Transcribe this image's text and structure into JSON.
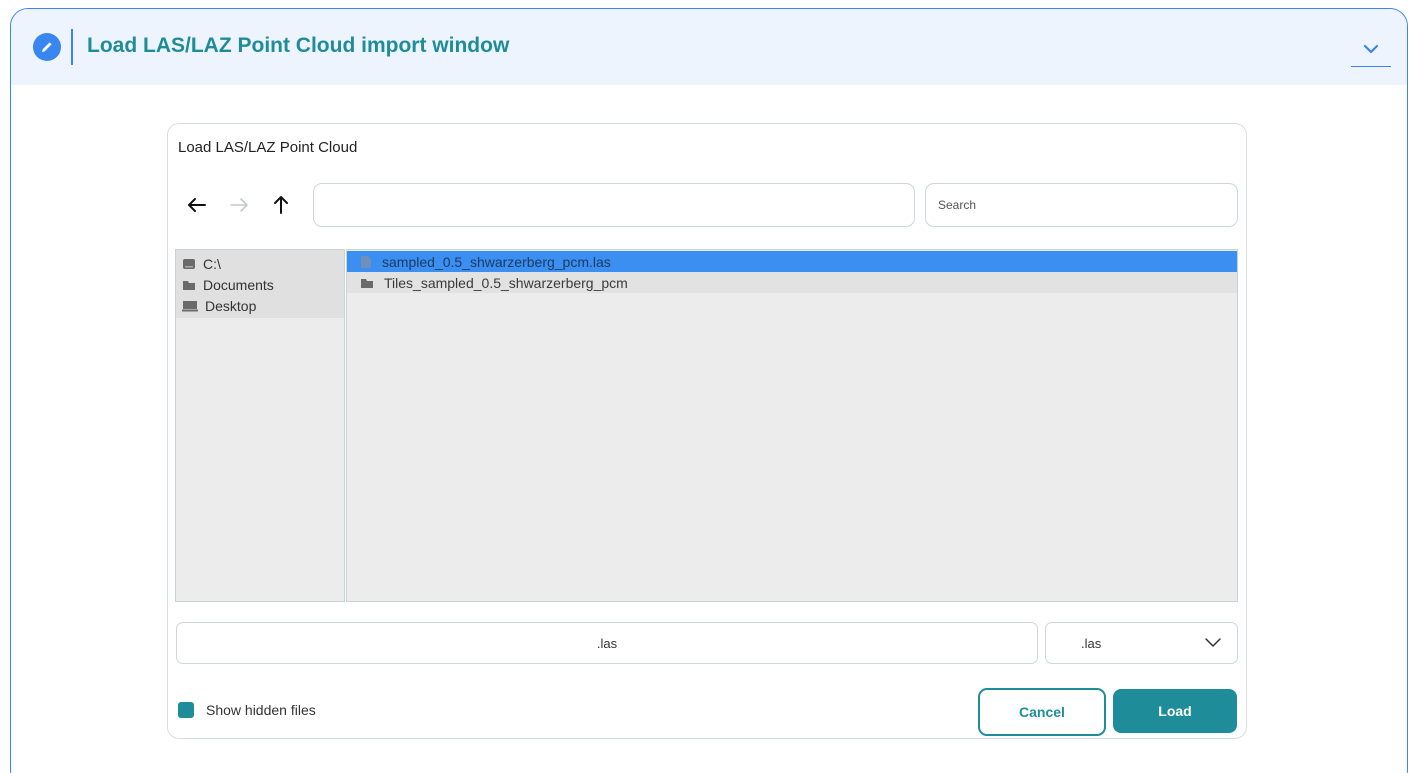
{
  "header": {
    "title": "Load LAS/LAZ Point Cloud import window",
    "edit_icon": "pencil-icon",
    "collapse_icon": "chevron-down-icon",
    "accent_color": "#3a86f0",
    "title_color": "#1f8c9a"
  },
  "dialog": {
    "title": "Load LAS/LAZ Point Cloud",
    "nav": {
      "back_icon": "arrow-left-icon",
      "forward_icon": "arrow-right-icon",
      "up_icon": "arrow-up-icon"
    },
    "path_value": "",
    "search_placeholder": "Search",
    "places": [
      {
        "label": "C:\\",
        "icon": "drive-icon"
      },
      {
        "label": "Documents",
        "icon": "folder-icon"
      },
      {
        "label": "Desktop",
        "icon": "desktop-icon"
      }
    ],
    "files": [
      {
        "name": "sampled_0.5_shwarzerberg_pcm.las",
        "icon": "file-icon",
        "selected": true
      },
      {
        "name": "Tiles_sampled_0.5_shwarzerberg_pcm",
        "icon": "folder-icon",
        "selected": false
      }
    ],
    "filename_value": ".las",
    "filter_value": ".las",
    "show_hidden_label": "Show hidden files",
    "show_hidden_checked": true,
    "cancel_label": "Cancel",
    "load_label": "Load",
    "selection_color": "#3a8ff0",
    "button_color": "#1f8c9a"
  }
}
